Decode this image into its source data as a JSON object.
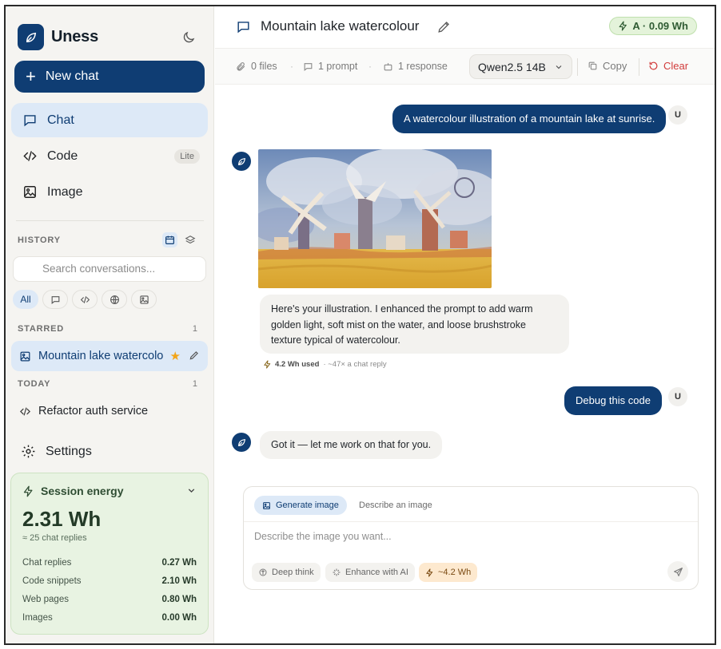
{
  "brand": {
    "name": "Uness"
  },
  "sidebar": {
    "new_chat_label": "New chat",
    "nav": [
      {
        "label": "Chat",
        "active": true
      },
      {
        "label": "Code",
        "badge": "Lite"
      },
      {
        "label": "Image"
      }
    ],
    "history_label": "HISTORY",
    "search_placeholder": "Search conversations...",
    "filters": [
      {
        "label": "All",
        "active": true
      }
    ],
    "starred": {
      "label": "STARRED",
      "count": "1",
      "items": [
        {
          "title": "Mountain lake watercolo",
          "starred": true
        }
      ]
    },
    "today": {
      "label": "TODAY",
      "count": "1",
      "items": [
        {
          "title": "Refactor auth service"
        }
      ]
    },
    "settings_label": "Settings"
  },
  "session_energy": {
    "title": "Session energy",
    "total": "2.31 Wh",
    "equivalent": "≈ 25 chat replies",
    "rows": [
      {
        "label": "Chat replies",
        "value": "0.27 Wh"
      },
      {
        "label": "Code snippets",
        "value": "2.10 Wh"
      },
      {
        "label": "Web pages",
        "value": "0.80 Wh"
      },
      {
        "label": "Images",
        "value": "0.00 Wh"
      }
    ]
  },
  "conversation": {
    "title": "Mountain lake watercolour",
    "energy_badge": "A · 0.09 Wh",
    "stats": {
      "files": "0 files",
      "prompts": "1 prompt",
      "responses": "1 response"
    },
    "model": "Qwen2.5 14B",
    "copy_label": "Copy",
    "clear_label": "Clear"
  },
  "messages": [
    {
      "role": "user",
      "avatar": "U",
      "text": "A watercolour illustration of a mountain lake at sunrise."
    },
    {
      "role": "assistant",
      "text": "Here's your illustration. I enhanced the prompt to add warm golden light, soft mist on the water, and loose brushstroke texture typical of watercolour.",
      "energy_used": "4.2 Wh used",
      "energy_compare": "· ~47× a chat reply"
    },
    {
      "role": "user",
      "avatar": "U",
      "text": "Debug this code"
    },
    {
      "role": "assistant",
      "text": "Got it — let me work on that for you."
    }
  ],
  "composer": {
    "tabs": [
      {
        "label": "Generate image",
        "active": true
      },
      {
        "label": "Describe an image"
      }
    ],
    "placeholder": "Describe the image you want...",
    "deep_think_label": "Deep think",
    "enhance_label": "Enhance with AI",
    "cost_label": "~4.2 Wh"
  },
  "colors": {
    "accent": "#0f3d73",
    "active_bg": "#dde9f7",
    "energy_bg": "#e8f3e2",
    "danger": "#d13b3b",
    "star": "#f2a51a"
  },
  "icons": [
    "leaf-icon",
    "moon-icon",
    "plus-icon",
    "chat-icon",
    "code-icon",
    "image-icon",
    "calendar-icon",
    "layers-icon",
    "search-icon",
    "globe-icon",
    "star-icon",
    "pencil-icon",
    "gear-icon",
    "bolt-icon",
    "chevron-down-icon",
    "paperclip-icon",
    "robot-icon",
    "copy-icon",
    "refresh-icon",
    "brain-icon",
    "sparkle-icon",
    "send-icon"
  ]
}
